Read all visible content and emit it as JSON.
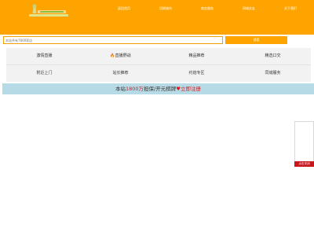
{
  "header": {
    "nav": [
      "返回首页",
      "切换城市",
      "商务服务",
      "同城交友",
      "关于我们"
    ]
  },
  "search": {
    "placeholder": "本站共有7800家店",
    "button_label": "搜索"
  },
  "categories": [
    {
      "label": "激情直播",
      "icon": ""
    },
    {
      "label": "直播野战",
      "icon": "fire-icon"
    },
    {
      "label": "精品推荐",
      "icon": ""
    },
    {
      "label": "精选口交",
      "icon": ""
    },
    {
      "label": "附近上门",
      "icon": ""
    },
    {
      "label": "站长推荐",
      "icon": ""
    },
    {
      "label": "约炮专区",
      "icon": ""
    },
    {
      "label": "同城服务",
      "icon": ""
    }
  ],
  "banner": {
    "prefix": "本站",
    "highlight": "1800万",
    "middle": "担保/开元棋牌",
    "heart": "♥",
    "cta": "立即注册"
  },
  "float_ad": {
    "close_label": "点击关闭"
  },
  "colors": {
    "header_bg": "#fea400",
    "banner_bg": "#b7dae7",
    "accent_red": "#d41e1e"
  }
}
